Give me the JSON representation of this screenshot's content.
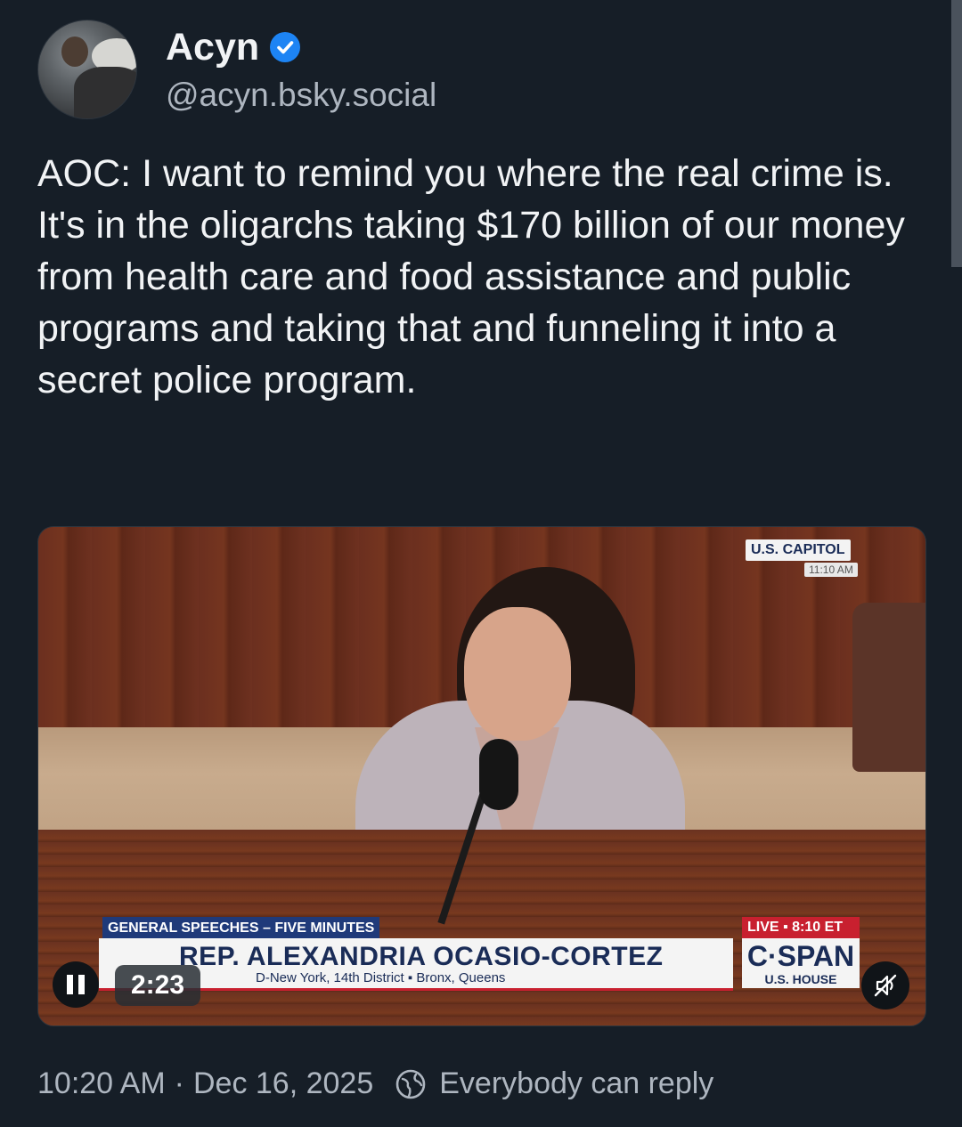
{
  "author": {
    "display_name": "Acyn",
    "handle": "@acyn.bsky.social",
    "verified": true
  },
  "post": {
    "text": "AOC: I want to remind you where the real crime is. It's in the oligarchs taking $170 billion of our money from health care and food assistance and public programs and taking that and funneling it into a secret police program."
  },
  "video": {
    "overlay_location": "U.S. CAPITOL",
    "overlay_location_time": "11:10 AM",
    "chyron_category": "GENERAL SPEECHES – FIVE MINUTES",
    "chyron_name": "REP. ALEXANDRIA OCASIO-CORTEZ",
    "chyron_subtitle": "D-New York, 14th District ▪ Bronx, Queens",
    "live_label": "LIVE ▪ 8:10 ET",
    "network": "C·SPAN",
    "network_sub": "U.S. HOUSE",
    "time_remaining": "2:23",
    "state": "playing",
    "muted": true
  },
  "meta": {
    "time": "10:20 AM",
    "separator": "·",
    "date": "Dec 16, 2025",
    "reply_setting": "Everybody can reply"
  },
  "colors": {
    "background": "#161e27",
    "text": "#f1f3f5",
    "muted_text": "#aeb6c0",
    "verified_badge": "#1d84f4"
  }
}
